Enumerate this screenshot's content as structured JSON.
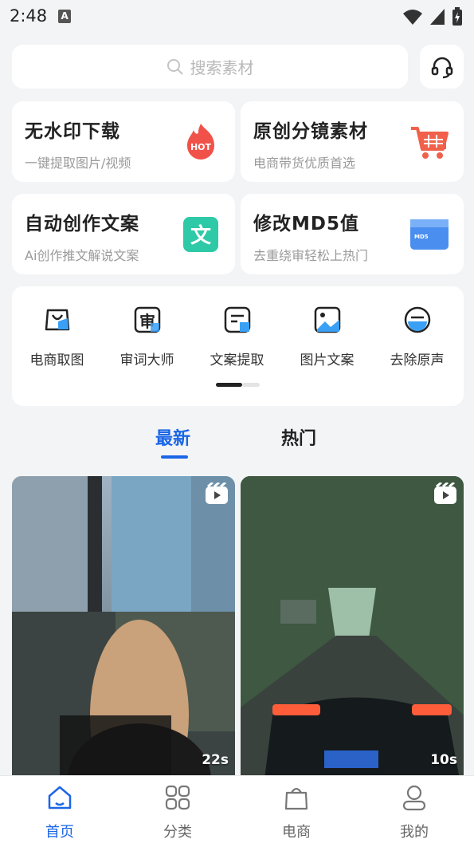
{
  "status_bar": {
    "time": "2:48",
    "a_label": "A"
  },
  "search": {
    "placeholder": "搜索素材"
  },
  "features": [
    {
      "title": "无水印下载",
      "subtitle": "一键提取图片/视频",
      "icon": "hot-icon",
      "icon_text": "HOT"
    },
    {
      "title": "原创分镜素材",
      "subtitle": "电商带货优质首选",
      "icon": "cart-icon"
    },
    {
      "title": "自动创作文案",
      "subtitle": "Ai创作推文解说文案",
      "icon": "wen-icon",
      "icon_text": "文"
    },
    {
      "title": "修改MD5值",
      "subtitle": "去重绕审轻松上热门",
      "icon": "md5-card-icon",
      "icon_text": "MD5"
    }
  ],
  "tools": [
    {
      "label": "电商取图",
      "icon": "shopping-bag-icon"
    },
    {
      "label": "审词大师",
      "icon": "audit-icon",
      "icon_text": "审"
    },
    {
      "label": "文案提取",
      "icon": "document-icon"
    },
    {
      "label": "图片文案",
      "icon": "image-icon"
    },
    {
      "label": "去除原声",
      "icon": "mute-icon"
    }
  ],
  "tabs": [
    {
      "label": "最新",
      "active": true
    },
    {
      "label": "热门",
      "active": false
    }
  ],
  "videos": [
    {
      "duration": "22s"
    },
    {
      "duration": "10s"
    }
  ],
  "nav": [
    {
      "label": "首页",
      "icon": "home-icon",
      "active": true
    },
    {
      "label": "分类",
      "icon": "grid-icon",
      "active": false
    },
    {
      "label": "电商",
      "icon": "bag-icon",
      "active": false
    },
    {
      "label": "我的",
      "icon": "user-icon",
      "active": false
    }
  ],
  "colors": {
    "accent": "#1a66e6",
    "background": "#f3f4f6"
  }
}
